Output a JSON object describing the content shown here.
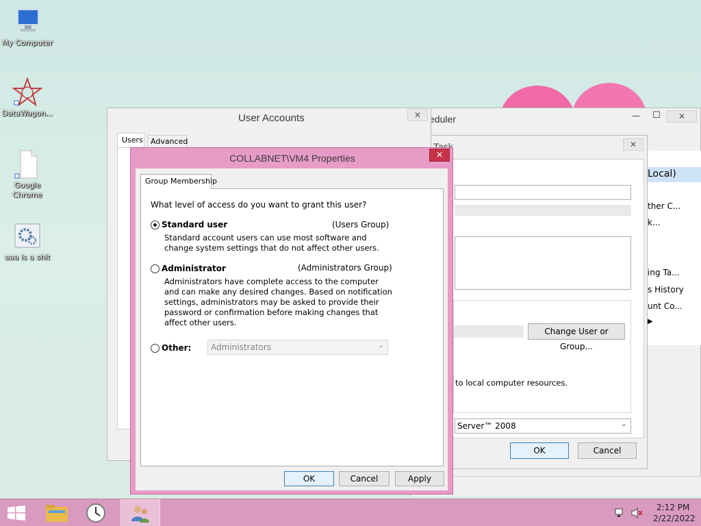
{
  "desktop": {
    "icons": [
      {
        "label": "My Computer"
      },
      {
        "label": "DataWagon..."
      },
      {
        "label": "Google Chrome"
      },
      {
        "label": "aaa is a shit"
      }
    ]
  },
  "user_accounts": {
    "title": "User Accounts",
    "tabs": [
      {
        "label": "Users"
      },
      {
        "label": "Advanced"
      }
    ],
    "close_glyph": "✕"
  },
  "scheduler": {
    "title_fragment": "eduler",
    "subtitle_fragment": "Task",
    "panel_fragments": [
      "Local)",
      "ther C...",
      "k...",
      "ing Ta...",
      "s History",
      "unt Co..."
    ],
    "change_button": "Change User or Group...",
    "resources_text": "to local computer resources.",
    "configure_value": "Server™ 2008",
    "ok": "OK",
    "cancel": "Cancel",
    "minimize_glyph": "—",
    "maximize_glyph": "☐",
    "close_glyph": "✕"
  },
  "properties": {
    "title": "COLLABNET\\VM4 Properties",
    "tab": "Group Membership",
    "question": "What level of access do you want to grant this user?",
    "standard": {
      "label": "Standard user",
      "group": "(Users Group)",
      "description": "Standard account users can use most software and change system settings that do not affect other users."
    },
    "administrator": {
      "label": "Administrator",
      "group": "(Administrators Group)",
      "description": "Administrators have complete access to the computer and can make any desired changes. Based on notification settings, administrators may be asked to provide their password or confirmation before making changes that affect other users."
    },
    "other": {
      "label": "Other:",
      "selected": "Administrators"
    },
    "buttons": {
      "ok": "OK",
      "cancel": "Cancel",
      "apply": "Apply"
    },
    "close_glyph": "✕"
  },
  "taskbar": {
    "time": "2:12 PM",
    "date": "2/22/2022"
  },
  "colors": {
    "accent": "#d99ac0",
    "dialog_frame": "#e79cc7",
    "close_red": "#c7344a"
  }
}
